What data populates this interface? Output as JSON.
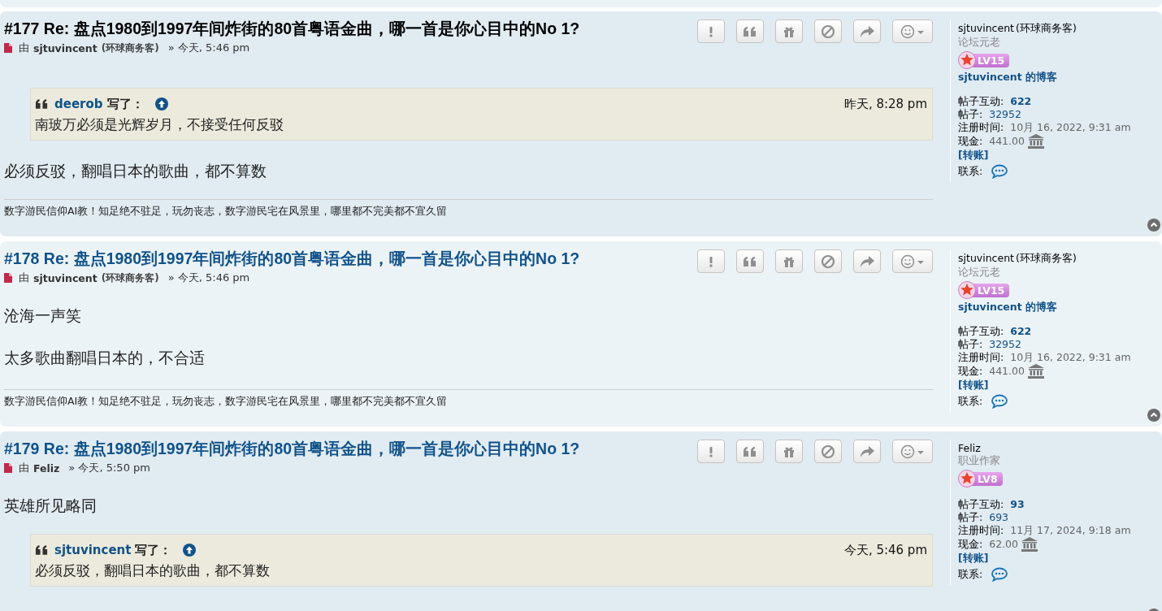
{
  "posts": [
    {
      "title_active": true,
      "title": "#177 Re: 盘点1980到1997年间炸街的80首粤语金曲，哪一首是你心目中的No 1?",
      "by": "由",
      "author": "sjtuvincent",
      "author_tag": "(环球商务客)",
      "time": "» 今天, 5:46 pm",
      "body": [
        {
          "kind": "quote",
          "user": "deerob",
          "wrote": "写了：",
          "time": "昨天, 8:28 pm",
          "text": "南玻万必须是光辉岁月，不接受任何反驳"
        },
        {
          "kind": "text",
          "text": "必须反驳，翻唱日本的歌曲，都不算数"
        }
      ],
      "signature": "数字游民信仰AI教！知足绝不驻足，玩勿丧志，数字游民宅在风景里，哪里都不完美都不宜久留",
      "profile": {
        "name": "sjtuvincent",
        "name_tag": "(环球商务客)",
        "rank": "论坛元老",
        "level_badge": "LV15",
        "blog": "sjtuvincent 的博客",
        "fields": [
          {
            "kind": "strong",
            "label": "帖子互动:",
            "value": "622"
          },
          {
            "kind": "link",
            "label": "帖子:",
            "value": "32952"
          },
          {
            "kind": "plain",
            "label": "注册时间:",
            "value": "10月 16, 2022, 9:31 am"
          },
          {
            "kind": "cash",
            "label": "现金:",
            "value": "441.00"
          }
        ],
        "transfer": "[转账]",
        "contact": "联系:"
      }
    },
    {
      "title_active": false,
      "title": "#178 Re: 盘点1980到1997年间炸街的80首粤语金曲，哪一首是你心目中的No 1?",
      "by": "由",
      "author": "sjtuvincent",
      "author_tag": "(环球商务客)",
      "time": "» 今天, 5:46 pm",
      "body": [
        {
          "kind": "text",
          "text": "沧海一声笑"
        },
        {
          "kind": "text",
          "text": "太多歌曲翻唱日本的，不合适"
        }
      ],
      "signature": "数字游民信仰AI教！知足绝不驻足，玩勿丧志，数字游民宅在风景里，哪里都不完美都不宜久留",
      "profile": {
        "name": "sjtuvincent",
        "name_tag": "(环球商务客)",
        "rank": "论坛元老",
        "level_badge": "LV15",
        "blog": "sjtuvincent 的博客",
        "fields": [
          {
            "kind": "strong",
            "label": "帖子互动:",
            "value": "622"
          },
          {
            "kind": "link",
            "label": "帖子:",
            "value": "32952"
          },
          {
            "kind": "plain",
            "label": "注册时间:",
            "value": "10月 16, 2022, 9:31 am"
          },
          {
            "kind": "cash",
            "label": "现金:",
            "value": "441.00"
          }
        ],
        "transfer": "[转账]",
        "contact": "联系:"
      }
    },
    {
      "title_active": false,
      "title": "#179 Re: 盘点1980到1997年间炸街的80首粤语金曲，哪一首是你心目中的No 1?",
      "by": "由",
      "author": "Feliz",
      "time": "» 今天, 5:50 pm",
      "body": [
        {
          "kind": "text",
          "text": "英雄所见略同"
        },
        {
          "kind": "quote",
          "user": "sjtuvincent",
          "wrote": "写了：",
          "time": "今天, 5:46 pm",
          "text": "必须反驳，翻唱日本的歌曲，都不算数"
        }
      ],
      "profile": {
        "name": "Feliz",
        "rank": "职业作家",
        "level_badge": "LV8",
        "fields": [
          {
            "kind": "strong",
            "label": "帖子互动:",
            "value": "93"
          },
          {
            "kind": "link",
            "label": "帖子:",
            "value": "693"
          },
          {
            "kind": "plain",
            "label": "注册时间:",
            "value": "11月 17, 2024, 9:18 am"
          },
          {
            "kind": "cash",
            "label": "现金:",
            "value": "62.00"
          }
        ],
        "transfer": "[转账]",
        "contact": "联系:"
      }
    }
  ]
}
